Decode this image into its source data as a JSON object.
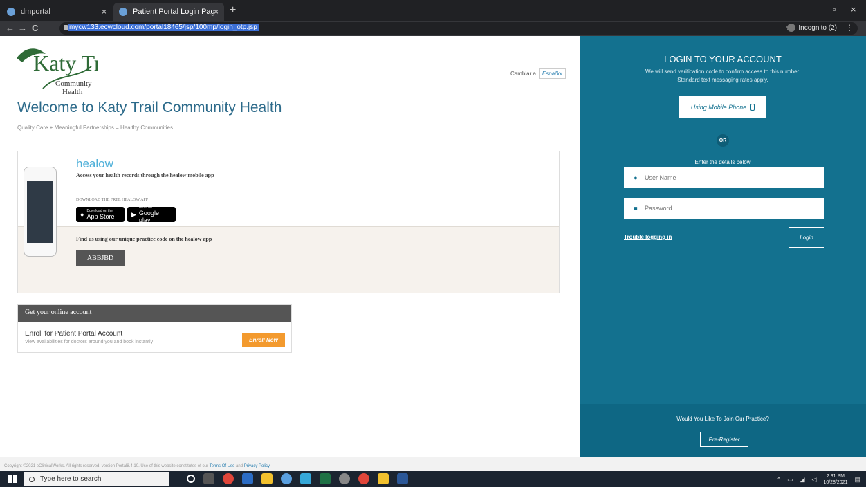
{
  "browser": {
    "tabs": [
      {
        "label": "dmportal",
        "close": "×"
      },
      {
        "label": "Patient Portal Login Page",
        "close": "×"
      }
    ],
    "new_tab": "+",
    "url": "mycw133.ecwcloud.com/portal18465/jsp/100mp/login_otp.jsp",
    "profile": "Incognito (2)",
    "controls": {
      "minimize": "–",
      "maximize": "▫",
      "close": "×"
    }
  },
  "page": {
    "logo": {
      "brand_top": "Katy Trail",
      "brand_sub1": "Community",
      "brand_sub2": "Health"
    },
    "language": {
      "label": "Cambiar a",
      "option": "Español"
    },
    "welcome": "Welcome to Katy Trail Community Health",
    "tagline": "Quality Care + Meaningful Partnerships = Healthy Communities",
    "healow": {
      "brand": "healow",
      "description": "Access your health records through the healow mobile app",
      "download_label": "DOWNLOAD THE FREE HEALOW APP",
      "app_store_small": "Download on the",
      "app_store": "App Store",
      "google_small": "Get it on",
      "google": "Google play",
      "find_text": "Find us using our unique practice code on the healow app",
      "practice_code": "ABBJBD"
    },
    "account": {
      "header": "Get your online account",
      "title": "Enroll for Patient Portal Account",
      "subtitle": "View availabilities for doctors around you and book instantly",
      "button": "Enroll Now"
    },
    "footer": {
      "text": "Copyright ©2021 eClinicalWorks. All rights reserved. version Portal8.4.10.  Use of this website constitutes of our",
      "terms": "Terms Of Use",
      "and": "and",
      "privacy": "Privacy Policy."
    }
  },
  "login": {
    "title": "LOGIN TO YOUR ACCOUNT",
    "subtitle_line1": "We will send verification code to confirm access to this number.",
    "subtitle_line2": "Standard text messaging rates apply.",
    "mobile_button": "Using Mobile Phone",
    "or": "OR",
    "enter_details": "Enter the details below",
    "username_placeholder": "User Name",
    "password_placeholder": "Password",
    "trouble": "Trouble logging in",
    "login_button": "Login",
    "join_text": "Would You Like To Join Our Practice?",
    "preregister": "Pre-Register"
  },
  "taskbar": {
    "search_placeholder": "Type here to search",
    "time": "2:31 PM",
    "date": "10/28/2021"
  },
  "colors": {
    "panel": "#13718f",
    "accent_orange": "#f39a2e",
    "welcome_blue": "#2c6a8a"
  }
}
